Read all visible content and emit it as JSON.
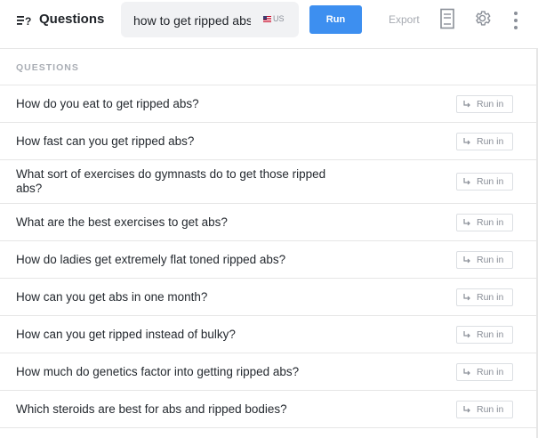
{
  "app": {
    "title": "Questions",
    "icon": "questions-list-icon"
  },
  "search": {
    "value": "how to get ripped abs",
    "locale": "US",
    "flag": "us-flag-icon"
  },
  "toolbar": {
    "run_label": "Run",
    "export_label": "Export",
    "run_color": "#3d8ff0",
    "icons": [
      "document-icon",
      "gear-icon",
      "more-vertical-icon"
    ]
  },
  "section": {
    "header": "QUESTIONS"
  },
  "questions": [
    {
      "text": "How do you eat to get ripped abs?",
      "action": "Run in"
    },
    {
      "text": "How fast can you get ripped abs?",
      "action": "Run in"
    },
    {
      "text": "What sort of exercises do gymnasts do to get those ripped abs?",
      "action": "Run in"
    },
    {
      "text": "What are the best exercises to get abs?",
      "action": "Run in"
    },
    {
      "text": "How do ladies get extremely flat toned ripped abs?",
      "action": "Run in"
    },
    {
      "text": "How can you get abs in one month?",
      "action": "Run in"
    },
    {
      "text": "How can you get ripped instead of bulky?",
      "action": "Run in"
    },
    {
      "text": "How much do genetics factor into getting ripped abs?",
      "action": "Run in"
    },
    {
      "text": "Which steroids are best for abs and ripped bodies?",
      "action": "Run in"
    }
  ]
}
